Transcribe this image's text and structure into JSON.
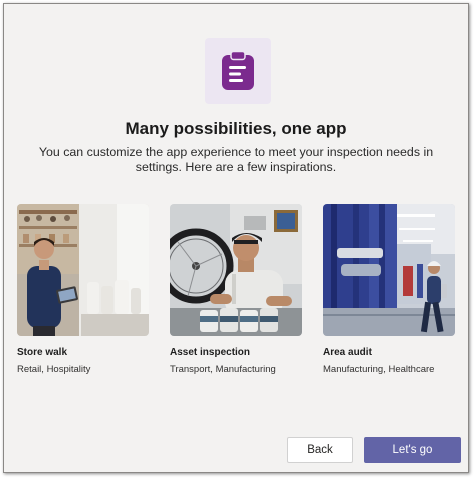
{
  "dialog": {
    "app_icon": "clipboard-icon",
    "heading": "Many possibilities, one app",
    "subtitle": "You can customize the app experience to meet your inspection needs in settings. Here are a few inspirations."
  },
  "cards": [
    {
      "title": "Store walk",
      "tags": "Retail, Hospitality",
      "image": "store-walk-photo"
    },
    {
      "title": "Asset inspection",
      "tags": "Transport, Manufacturing",
      "image": "asset-inspection-photo"
    },
    {
      "title": "Area audit",
      "tags": "Manufacturing, Healthcare",
      "image": "area-audit-photo"
    }
  ],
  "buttons": {
    "back_label": "Back",
    "go_label": "Let's go"
  },
  "colors": {
    "accent": "#6264a7",
    "icon_purple": "#7b2a8e",
    "icon_tile": "#ece6f2"
  }
}
